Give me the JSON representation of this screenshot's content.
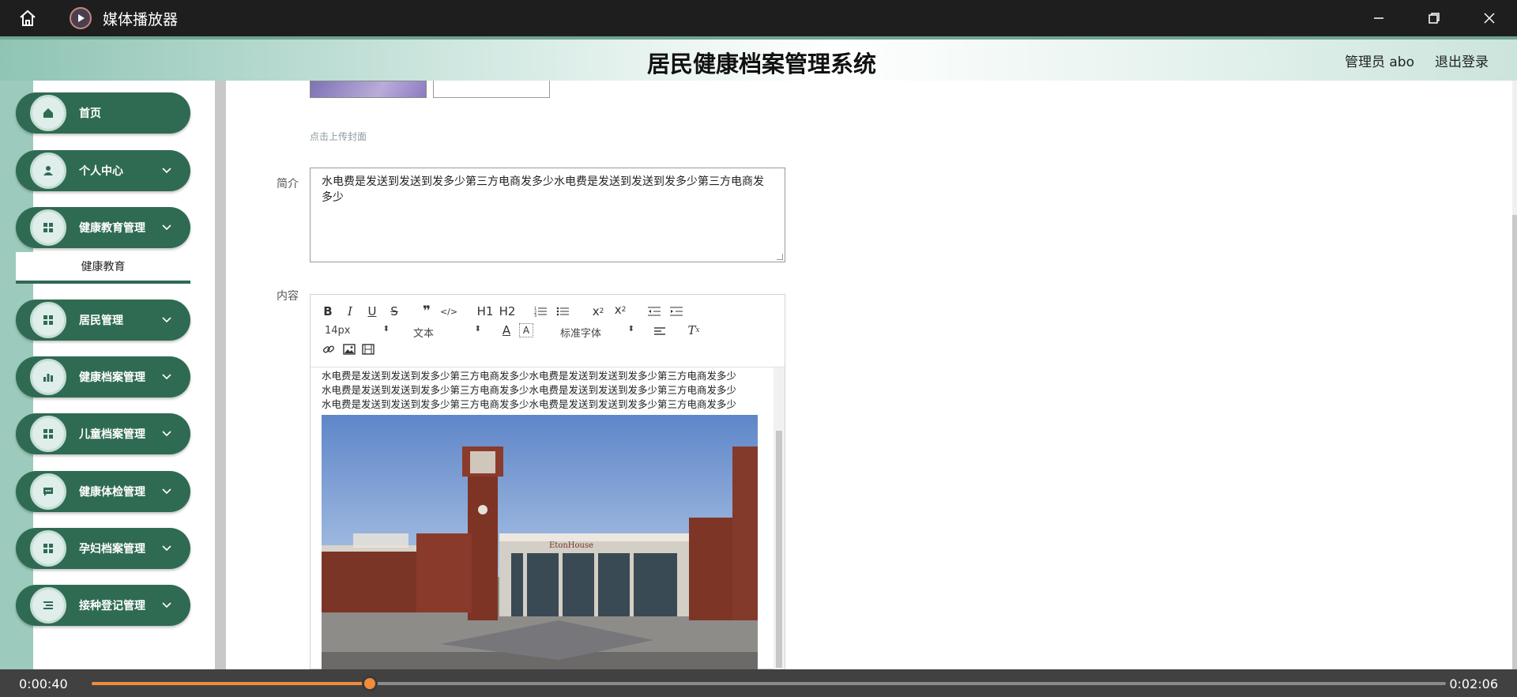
{
  "player": {
    "title": "媒体播放器",
    "current_time": "0:00:40",
    "total_time": "0:02:06",
    "progress": 0.2055
  },
  "header": {
    "app_title": "居民健康档案管理系统",
    "user_label": "管理员 abo",
    "logout_label": "退出登录"
  },
  "sidebar": {
    "items": [
      {
        "label": "首页",
        "icon": "home-icon",
        "has_chevron": false
      },
      {
        "label": "个人中心",
        "icon": "user-icon",
        "has_chevron": true
      },
      {
        "label": "健康教育管理",
        "icon": "grid-icon",
        "has_chevron": true
      },
      {
        "label": "居民管理",
        "icon": "grid-icon",
        "has_chevron": true
      },
      {
        "label": "健康档案管理",
        "icon": "bar-chart-icon",
        "has_chevron": true
      },
      {
        "label": "儿童档案管理",
        "icon": "grid-icon",
        "has_chevron": true
      },
      {
        "label": "健康体检管理",
        "icon": "chat-icon",
        "has_chevron": true
      },
      {
        "label": "孕妇档案管理",
        "icon": "grid-icon",
        "has_chevron": true
      },
      {
        "label": "接种登记管理",
        "icon": "list-icon",
        "has_chevron": true
      }
    ],
    "submenu_label": "健康教育"
  },
  "form": {
    "upload_hint": "点击上传封面",
    "intro_label": "简介",
    "intro_value": "水电费是发送到发送到发多少第三方电商发多少水电费是发送到发送到发多少第三方电商发多少",
    "content_label": "内容",
    "content_lines": [
      "水电费是发送到发送到发多少第三方电商发多少水电费是发送到发送到发多少第三方电商发多少",
      "水电费是发送到发送到发多少第三方电商发多少水电费是发送到发送到发多少第三方电商发多少",
      "水电费是发送到发送到发多少第三方电商发多少水电费是发送到发送到发多少第三方电商发多少"
    ],
    "photo_sign": "EtonHouse"
  },
  "editor_toolbar": {
    "font_size": "14px",
    "block_type": "文本",
    "font_family": "标准字体",
    "h1": "H1",
    "h2": "H2"
  }
}
